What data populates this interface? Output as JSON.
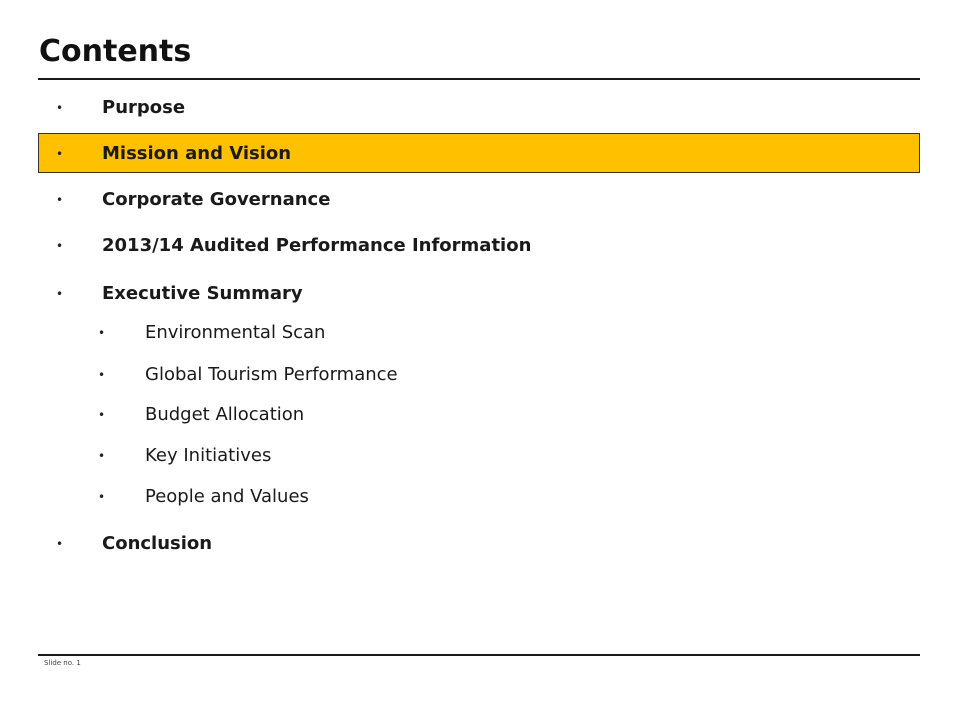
{
  "slide": {
    "title": "Contents",
    "highlight_color": "#ffc000",
    "bullet_glyph": "•",
    "items": [
      {
        "label": "Purpose",
        "level": 1,
        "highlighted": false
      },
      {
        "label": "Mission and Vision",
        "level": 1,
        "highlighted": true
      },
      {
        "label": "Corporate Governance",
        "level": 1,
        "highlighted": false
      },
      {
        "label": "2013/14 Audited Performance Information",
        "level": 1,
        "highlighted": false
      },
      {
        "label": "Executive Summary",
        "level": 1,
        "highlighted": false
      },
      {
        "label": "Environmental Scan",
        "level": 2,
        "highlighted": false
      },
      {
        "label": "Global Tourism Performance",
        "level": 2,
        "highlighted": false
      },
      {
        "label": "Budget Allocation",
        "level": 2,
        "highlighted": false
      },
      {
        "label": "Key Initiatives",
        "level": 2,
        "highlighted": false
      },
      {
        "label": "People and Values",
        "level": 2,
        "highlighted": false
      },
      {
        "label": "Conclusion",
        "level": 1,
        "highlighted": false
      }
    ],
    "footer": "Slide no. 1"
  }
}
